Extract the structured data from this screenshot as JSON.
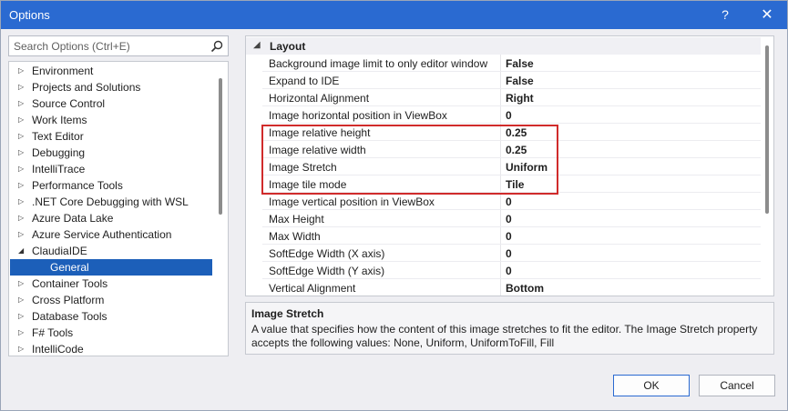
{
  "window": {
    "title": "Options",
    "help": "?",
    "close": "✕"
  },
  "search": {
    "placeholder": "Search Options (Ctrl+E)"
  },
  "tree": [
    {
      "label": "Environment",
      "arrow": "▷",
      "state": "collapsed"
    },
    {
      "label": "Projects and Solutions",
      "arrow": "▷",
      "state": "collapsed"
    },
    {
      "label": "Source Control",
      "arrow": "▷",
      "state": "collapsed"
    },
    {
      "label": "Work Items",
      "arrow": "▷",
      "state": "collapsed"
    },
    {
      "label": "Text Editor",
      "arrow": "▷",
      "state": "collapsed"
    },
    {
      "label": "Debugging",
      "arrow": "▷",
      "state": "collapsed"
    },
    {
      "label": "IntelliTrace",
      "arrow": "▷",
      "state": "collapsed"
    },
    {
      "label": "Performance Tools",
      "arrow": "▷",
      "state": "collapsed"
    },
    {
      "label": ".NET Core Debugging with WSL",
      "arrow": "▷",
      "state": "collapsed"
    },
    {
      "label": "Azure Data Lake",
      "arrow": "▷",
      "state": "collapsed"
    },
    {
      "label": "Azure Service Authentication",
      "arrow": "▷",
      "state": "collapsed"
    },
    {
      "label": "ClaudiaIDE",
      "arrow": "◢",
      "state": "expanded"
    },
    {
      "label": "General",
      "arrow": "",
      "state": "selected-child"
    },
    {
      "label": "Container Tools",
      "arrow": "▷",
      "state": "collapsed"
    },
    {
      "label": "Cross Platform",
      "arrow": "▷",
      "state": "collapsed"
    },
    {
      "label": "Database Tools",
      "arrow": "▷",
      "state": "collapsed"
    },
    {
      "label": "F# Tools",
      "arrow": "▷",
      "state": "collapsed"
    },
    {
      "label": "IntelliCode",
      "arrow": "▷",
      "state": "collapsed"
    }
  ],
  "grid": {
    "section": {
      "label": "Layout",
      "arrow": "◢"
    },
    "properties": [
      {
        "name": "Background image limit to only editor window",
        "value": "False"
      },
      {
        "name": "Expand to IDE",
        "value": "False"
      },
      {
        "name": "Horizontal Alignment",
        "value": "Right"
      },
      {
        "name": "Image horizontal position in ViewBox",
        "value": "0"
      },
      {
        "name": "Image relative height",
        "value": "0.25"
      },
      {
        "name": "Image relative width",
        "value": "0.25"
      },
      {
        "name": "Image Stretch",
        "value": "Uniform"
      },
      {
        "name": "Image tile mode",
        "value": "Tile"
      },
      {
        "name": "Image vertical position in ViewBox",
        "value": "0"
      },
      {
        "name": "Max Height",
        "value": "0"
      },
      {
        "name": "Max Width",
        "value": "0"
      },
      {
        "name": "SoftEdge Width (X axis)",
        "value": "0"
      },
      {
        "name": "SoftEdge Width (Y axis)",
        "value": "0"
      },
      {
        "name": "Vertical Alignment",
        "value": "Bottom"
      }
    ]
  },
  "description": {
    "title": "Image Stretch",
    "text": "A value that specifies how the content of this image stretches to fit the editor. The Image Stretch property accepts the following values: None, Uniform, UniformToFill, Fill"
  },
  "buttons": {
    "ok": "OK",
    "cancel": "Cancel"
  },
  "colors": {
    "titlebar": "#2a6ad1",
    "selection": "#1c5fb9",
    "highlight_box": "#d02b2b"
  }
}
